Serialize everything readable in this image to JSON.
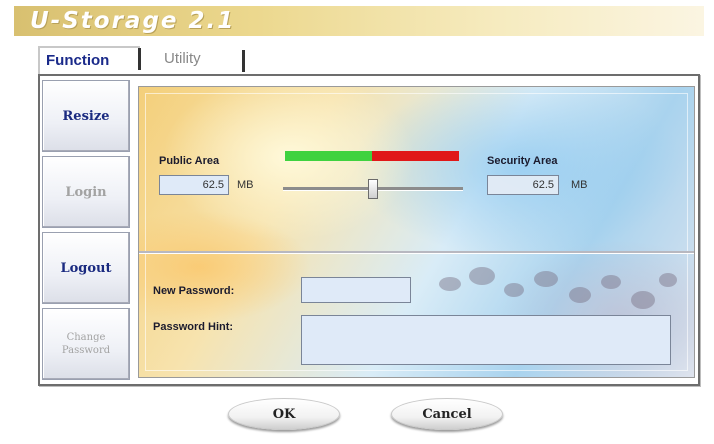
{
  "app": {
    "title": "U-Storage 2.1"
  },
  "tabs": [
    {
      "label": "Function",
      "selected": true
    },
    {
      "label": "Utility",
      "selected": false
    }
  ],
  "menu": [
    {
      "label": "Resize",
      "state": "active"
    },
    {
      "label": "Login",
      "state": "disabled"
    },
    {
      "label": "Logout",
      "state": "active"
    },
    {
      "label": "Change Password",
      "line1": "Change",
      "line2": "Password",
      "state": "disabled"
    }
  ],
  "partition": {
    "public_label": "Public Area",
    "public_value": "62.5",
    "public_unit": "MB",
    "security_label": "Security Area",
    "security_value": "62.5",
    "security_unit": "MB",
    "split_fraction": 0.5,
    "public_color": "#3fd23f",
    "security_color": "#e01818"
  },
  "password": {
    "new_label": "New Password:",
    "new_value": "",
    "hint_label": "Password Hint:",
    "hint_value": ""
  },
  "buttons": {
    "ok": "OK",
    "cancel": "Cancel"
  }
}
